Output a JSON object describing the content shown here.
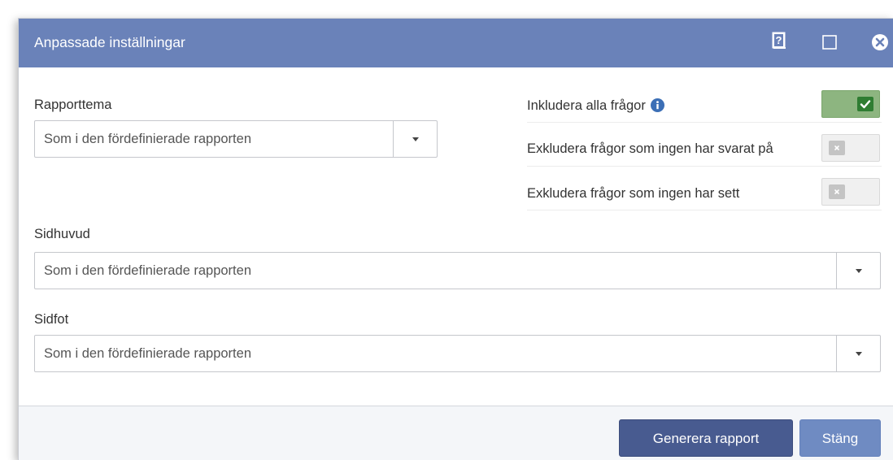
{
  "dialog": {
    "title": "Anpassade inställningar",
    "icons": [
      "help-icon",
      "maximize-icon",
      "close-icon"
    ]
  },
  "form": {
    "theme": {
      "label": "Rapporttema",
      "value": "Som i den fördefinierade rapporten"
    },
    "header": {
      "label": "Sidhuvud",
      "value": "Som i den fördefinierade rapporten"
    },
    "footer": {
      "label": "Sidfot",
      "value": "Som i den fördefinierade rapporten"
    }
  },
  "options": [
    {
      "label": "Inkludera alla frågor",
      "enabled": true,
      "has_info": true
    },
    {
      "label": "Exkludera frågor som ingen har svarat på",
      "enabled": false
    },
    {
      "label": "Exkludera frågor som ingen har sett",
      "enabled": false
    }
  ],
  "buttons": {
    "generate": "Generera rapport",
    "close": "Stäng"
  },
  "colors": {
    "titlebar": "#6a82b9",
    "toggle_on": "#8db580",
    "toggle_on_knob": "#2f7d32",
    "primary_button": "#485b90",
    "secondary_button": "#6f8bc2",
    "info_icon": "#3c6fb6"
  }
}
